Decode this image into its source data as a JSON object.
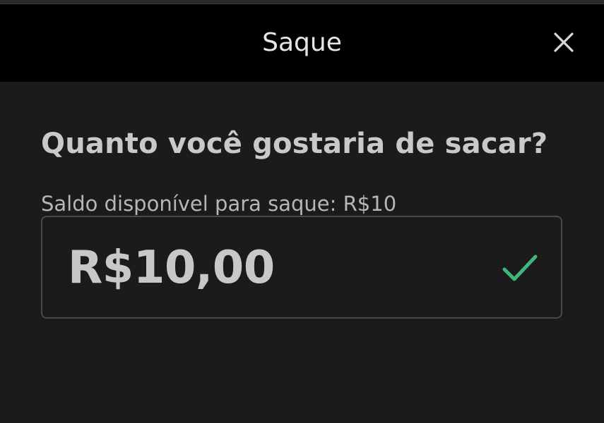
{
  "dialog": {
    "title": "Saque",
    "close_icon": "close-icon"
  },
  "withdraw": {
    "question": "Quanto você gostaria de sacar?",
    "balance_label": "Saldo disponível para saque: R$10",
    "amount_value": "R$10,00",
    "valid_icon": "check-icon"
  },
  "colors": {
    "header_bg": "#000000",
    "body_bg": "#1b1b1b",
    "check": "#3fb67a",
    "field_border": "#4a4a4a"
  }
}
